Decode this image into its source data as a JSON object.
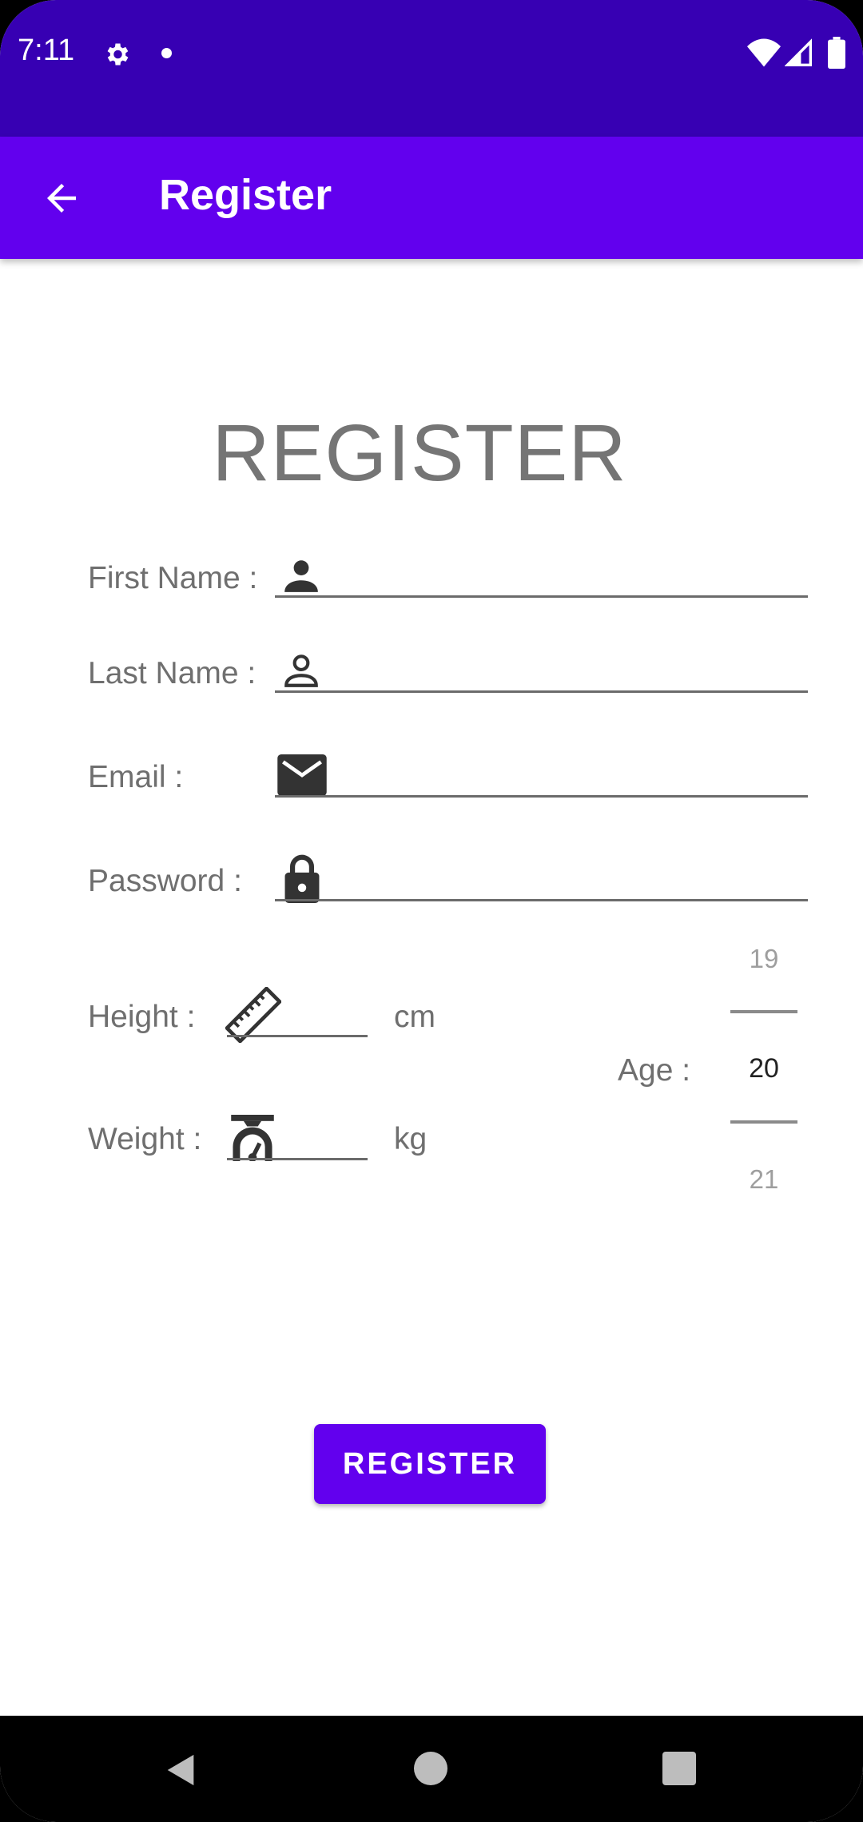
{
  "status_bar": {
    "time": "7:11",
    "icons": [
      "gear-icon",
      "notification-dot-icon",
      "wifi-icon",
      "signal-icon",
      "battery-icon"
    ]
  },
  "app_bar": {
    "back_icon": "arrow-left-icon",
    "title": "Register"
  },
  "heading": "REGISTER",
  "form": {
    "first_name": {
      "label": "First Name :",
      "icon": "person-filled-icon",
      "value": ""
    },
    "last_name": {
      "label": "Last Name :",
      "icon": "person-outline-icon",
      "value": ""
    },
    "email": {
      "label": "Email :",
      "icon": "email-icon",
      "value": ""
    },
    "password": {
      "label": "Password :",
      "icon": "lock-icon",
      "value": ""
    },
    "height": {
      "label": "Height :",
      "icon": "ruler-icon",
      "unit": "cm",
      "value": ""
    },
    "weight": {
      "label": "Weight :",
      "icon": "scale-icon",
      "unit": "kg",
      "value": ""
    },
    "age": {
      "label": "Age :",
      "previous": "19",
      "selected": "20",
      "next": "21"
    }
  },
  "register_button": "REGISTER",
  "nav_bar": {
    "icons": [
      "nav-back-icon",
      "nav-home-icon",
      "nav-recents-icon"
    ]
  },
  "colors": {
    "status_bar": "#3700B3",
    "primary": "#6200EE",
    "label_text": "#6f6f6f",
    "heading_text": "#757575"
  }
}
